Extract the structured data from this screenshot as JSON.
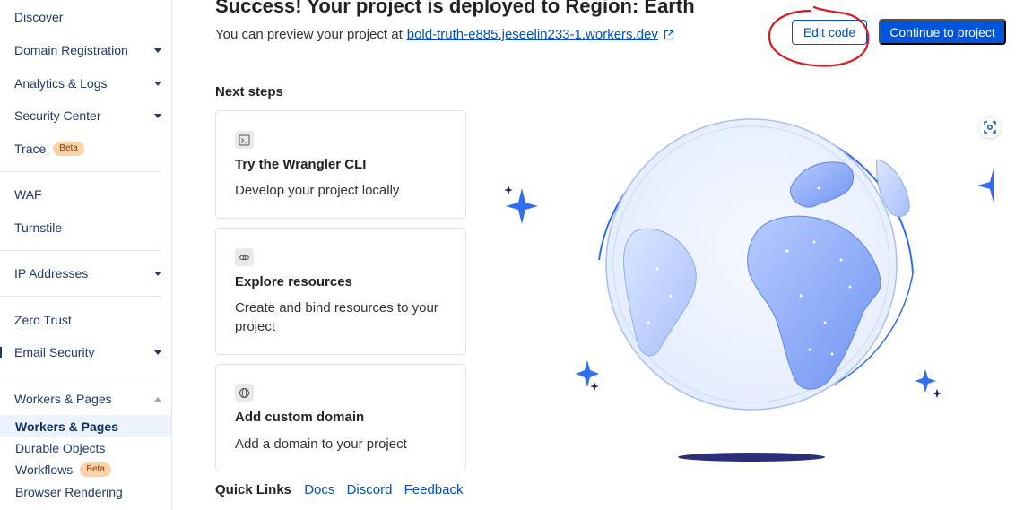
{
  "sidebar": {
    "items": [
      {
        "label": "Discover"
      },
      {
        "label": "Domain Registration"
      },
      {
        "label": "Analytics & Logs"
      },
      {
        "label": "Security Center"
      },
      {
        "label": "Trace",
        "badge": "Beta"
      },
      {
        "label": "WAF"
      },
      {
        "label": "Turnstile"
      },
      {
        "label": "IP Addresses"
      },
      {
        "label": "Zero Trust"
      },
      {
        "label": "Email Security"
      },
      {
        "label": "Workers & Pages"
      }
    ],
    "sub_items": [
      {
        "label": "Workers & Pages"
      },
      {
        "label": "Durable Objects"
      },
      {
        "label": "Workflows",
        "badge": "Beta"
      },
      {
        "label": "Browser Rendering"
      }
    ]
  },
  "header": {
    "title": "Success! Your project is deployed to Region: Earth",
    "preview_text": "You can preview your project at",
    "preview_link": "bold-truth-e885.jeseelin233-1.workers.dev",
    "edit_code_label": "Edit code",
    "continue_label": "Continue to project"
  },
  "next_steps": {
    "heading": "Next steps",
    "cards": [
      {
        "icon": "terminal-icon",
        "title": "Try the Wrangler CLI",
        "desc": "Develop your project locally"
      },
      {
        "icon": "link-icon",
        "title": "Explore resources",
        "desc": "Create and bind resources to your project"
      },
      {
        "icon": "globe-icon",
        "title": "Add custom domain",
        "desc": "Add a domain to your project"
      }
    ]
  },
  "quick_links": {
    "label": "Quick Links",
    "links": [
      "Docs",
      "Discord",
      "Feedback"
    ]
  },
  "colors": {
    "primary": "#0055dc",
    "link": "#0051c3",
    "annotation": "#e0161e",
    "badge_bg": "#fbd2a8"
  }
}
